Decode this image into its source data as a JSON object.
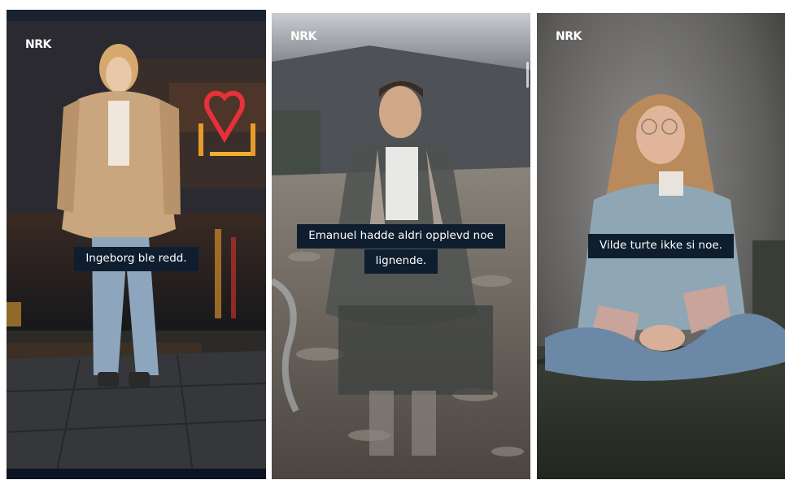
{
  "brand": "NRK",
  "colors": {
    "caption_bg": "#0f1e2f",
    "caption_text": "#ffffff",
    "page_bg": "#ffffff"
  },
  "panels": [
    {
      "caption_lines": [
        "Ingeborg ble redd."
      ]
    },
    {
      "caption_lines": [
        "Emanuel hadde aldri opplevd noe",
        "lignende."
      ]
    },
    {
      "caption_lines": [
        "Vilde turte ikke si noe."
      ]
    }
  ]
}
